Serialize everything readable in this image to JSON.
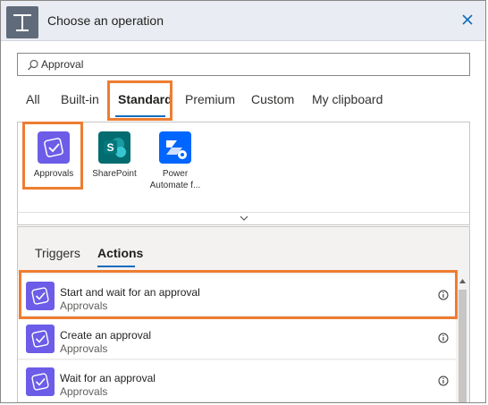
{
  "header": {
    "title": "Choose an operation"
  },
  "search": {
    "value": "Approval"
  },
  "tabs": [
    {
      "label": "All"
    },
    {
      "label": "Built-in"
    },
    {
      "label": "Standard"
    },
    {
      "label": "Premium"
    },
    {
      "label": "Custom"
    },
    {
      "label": "My clipboard"
    }
  ],
  "connectors": [
    {
      "label": "Approvals",
      "icon": "approvals-icon",
      "color": "#6c5ce7"
    },
    {
      "label": "SharePoint",
      "icon": "sharepoint-icon",
      "color": "#036c70"
    },
    {
      "label": "Power Automate f...",
      "icon": "power-automate-icon",
      "color": "#0066ff"
    }
  ],
  "subtabs": [
    {
      "label": "Triggers"
    },
    {
      "label": "Actions"
    }
  ],
  "actions": [
    {
      "title": "Start and wait for an approval",
      "subtitle": "Approvals"
    },
    {
      "title": "Create an approval",
      "subtitle": "Approvals"
    },
    {
      "title": "Wait for an approval",
      "subtitle": "Approvals"
    }
  ],
  "colors": {
    "highlight": "#ee7d31",
    "accent": "#0f6cbd"
  }
}
